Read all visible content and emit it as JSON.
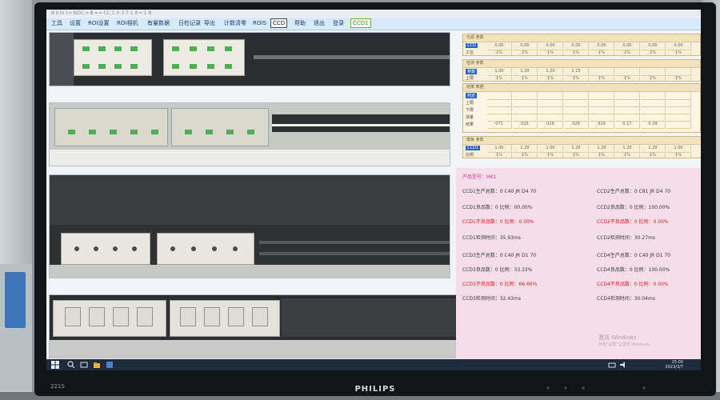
{
  "window": {
    "title": "Ⅲ Ⅱ Ⅳ Ⅰ ━ NOC ━ Ⅲ ━ ━ CC 1 0 3 7 1 8 ━ 1 8"
  },
  "menu": [
    "工具",
    "设置",
    "ROI设置",
    "ROI相机",
    "有量数据",
    "日检记录",
    "导出",
    "计数清零",
    "ROIS",
    "CCD",
    "帮助",
    "退出",
    "登录",
    "CCD1"
  ],
  "colors": {
    "accent_green": "#4e9a2e",
    "alarm_red": "#e02020",
    "stats_bg": "#f6dde9",
    "grid_bg": "#f7f0d8"
  },
  "grids": [
    {
      "head": "光源 参数",
      "rows": [
        "CCD",
        "工位"
      ],
      "selected_row": "CCD",
      "cells": [
        [
          "0.00",
          "0.00",
          "0.00",
          "0.00",
          "0.00",
          "0.00",
          "0.00",
          "0.00"
        ],
        [
          "1%",
          "1%",
          "1%",
          "1%",
          "1%",
          "1%",
          "1%",
          "1%"
        ]
      ]
    },
    {
      "head": "检测 参数",
      "rows": [
        "参数",
        "上限"
      ],
      "selected_row": "参数",
      "cells": [
        [
          "1.00",
          "1.20",
          "1.20",
          "1.15",
          "",
          "",
          "",
          ""
        ],
        [
          "1%",
          "1%",
          "1%",
          "1%",
          "1%",
          "1%",
          "1%",
          "1%"
        ]
      ]
    },
    {
      "head": "结果 数据",
      "rows": [
        "判定",
        "上限",
        "下限",
        "测量",
        "结果"
      ],
      "selected_row": "判定",
      "cells": [
        [
          "",
          "",
          "",
          "",
          "",
          "",
          "",
          ""
        ],
        [
          "",
          "",
          "",
          "",
          "",
          "",
          "",
          ""
        ],
        [
          "",
          "",
          "",
          "",
          "",
          "",
          "",
          ""
        ],
        [
          "",
          "",
          "",
          "",
          "",
          "",
          "",
          ""
        ],
        [
          "071",
          "025",
          "029",
          "028",
          "029",
          "0.17",
          "0.28",
          ""
        ]
      ]
    },
    {
      "head": "模板 参数",
      "rows": [
        "CCD1",
        "比例"
      ],
      "selected_row": "CCD1",
      "cells": [
        [
          "1.00",
          "1.20",
          "1.00",
          "1.20",
          "1.20",
          "1.20",
          "1.20",
          "1.00"
        ],
        [
          "1%",
          "1%",
          "1%",
          "1%",
          "1%",
          "1%",
          "1%",
          "1%"
        ]
      ]
    }
  ],
  "stats": {
    "header": "产品型号：HK1",
    "left": [
      {
        "text": "CCD1生产总数：0  C40 JR D4 70",
        "red": false
      },
      {
        "text": "CCD1良品数：0  比例：00.00%",
        "red": false
      },
      {
        "text": "CCD1不良品数：0  比例：0.00%",
        "red": true
      },
      {
        "text": "CCD1检测时间：35.93ms",
        "red": false
      },
      {
        "text": "CCD3生产总数：0  C40 JR D1 70",
        "red": false
      },
      {
        "text": "CCD3良品数：0  比例：33.33%",
        "red": false
      },
      {
        "text": "CCD3不良品数：0  比例：66.66%",
        "red": true
      },
      {
        "text": "CCD3检测时间：32.43ms",
        "red": false
      }
    ],
    "right": [
      {
        "text": "CCD2生产总数：0  C81 JR D4 70",
        "red": false
      },
      {
        "text": "CCD2良品数：0  比例：100.00%",
        "red": false
      },
      {
        "text": "CCD2不良品数：0  比例：0.00%",
        "red": true
      },
      {
        "text": "CCD2检测时间：30.27ms",
        "red": false
      },
      {
        "text": "CCD4生产总数：0  C40 JR D1 70",
        "red": false
      },
      {
        "text": "CCD4良品数：0  比例：100.00%",
        "red": false
      },
      {
        "text": "CCD4不良品数：0  比例：0.00%",
        "red": true
      },
      {
        "text": "CCD4检测时间：30.04ms",
        "red": false
      }
    ]
  },
  "watermark": {
    "line1": "激活 Windows",
    "line2": "转到\"设置\"以激活 Windows。"
  },
  "taskbar": {
    "time": "15:00",
    "date": "2023/3/7"
  },
  "monitor": {
    "brand": "PHILIPS",
    "model": "221S"
  }
}
